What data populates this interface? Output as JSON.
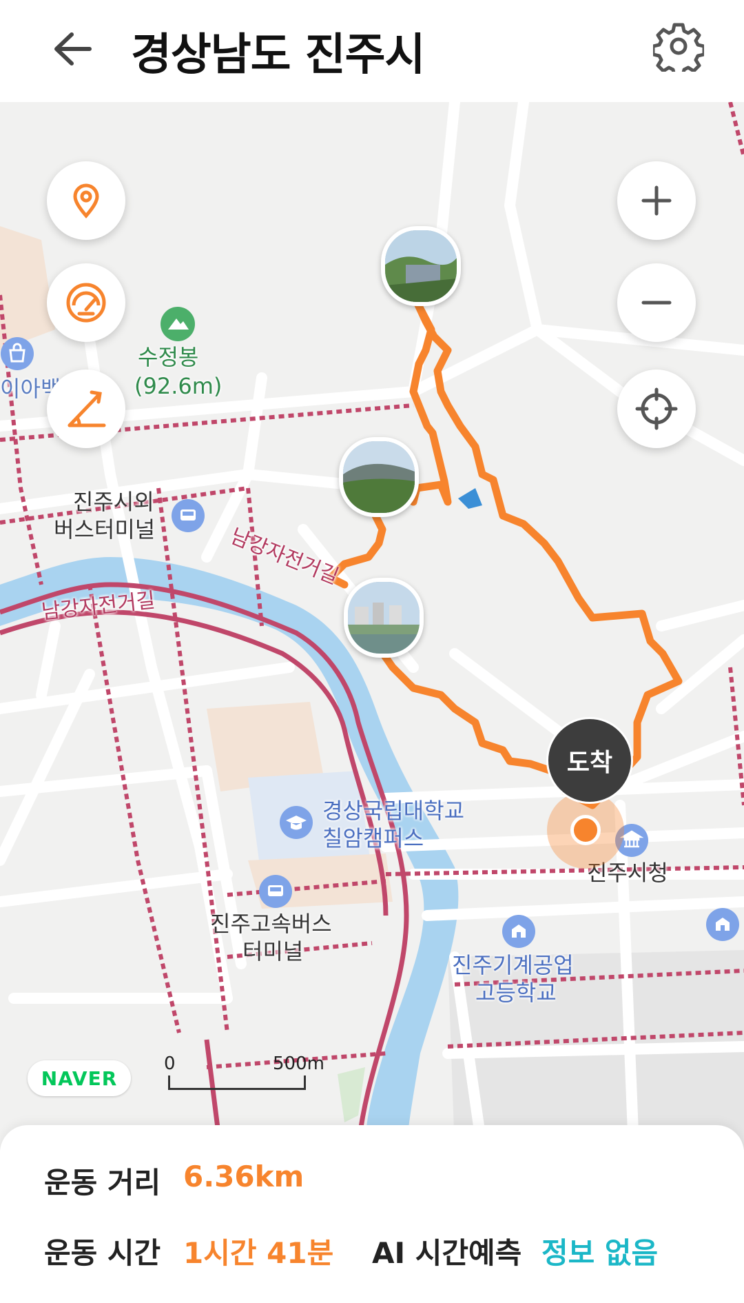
{
  "header": {
    "title": "경상남도 진주시",
    "back_icon": "arrow-left-icon",
    "settings_icon": "gear-icon"
  },
  "map": {
    "labels": {
      "peak_name": "수정봉",
      "peak_height": "(92.6m)",
      "department_store": "이아백화",
      "bus_terminal_line1": "진주시외",
      "bus_terminal_line2": "버스터미널",
      "bike_road_1": "남강자전거길",
      "bike_road_2": "남강자전거길",
      "university_line1": "경상국립대학교",
      "university_line2": "칠암캠퍼스",
      "express_bus_line1": "진주고속버스",
      "express_bus_line2": "터미널",
      "city_hall": "진주시청",
      "school_line1": "진주기계공업",
      "school_line2": "고등학교"
    },
    "arrival_label": "도착",
    "naver_logo": "NAVER",
    "scale": {
      "start": "0",
      "end": "500m"
    },
    "colors": {
      "route": "#f7842d",
      "river": "#a9d3f0",
      "road": "#ffffff",
      "bike_path": "#c0476a",
      "park": "#d8ead3"
    }
  },
  "controls": {
    "left": [
      "location-pin-icon",
      "speedometer-icon",
      "slope-icon"
    ],
    "right": [
      "zoom-in-icon",
      "zoom-out-icon",
      "crosshair-icon"
    ]
  },
  "stats": {
    "distance_label": "운동 거리",
    "distance_value": "6.36km",
    "time_label": "운동 시간",
    "time_value": "1시간 41분",
    "ai_label": "AI 시간예측",
    "ai_value": "정보 없음"
  }
}
